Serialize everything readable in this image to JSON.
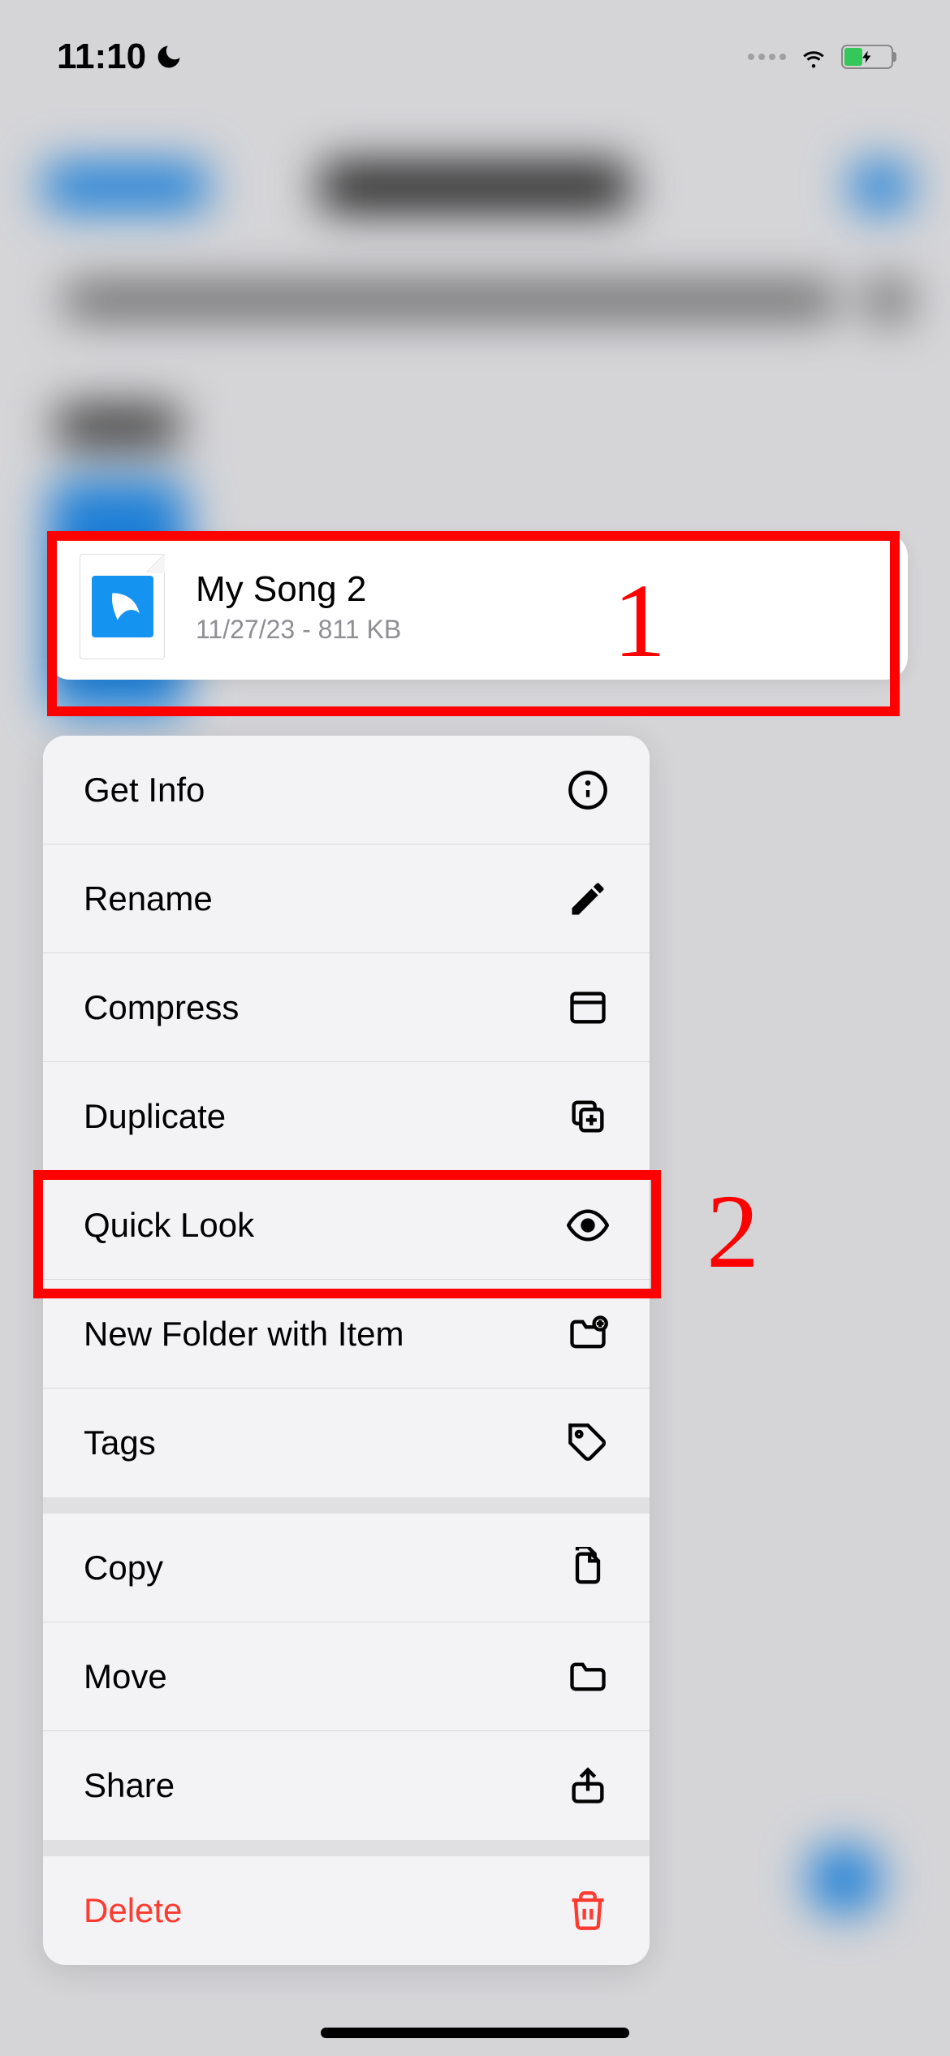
{
  "status_bar": {
    "time": "11:10"
  },
  "file": {
    "name": "My Song 2",
    "date": "11/27/23",
    "size": "811 KB"
  },
  "menu": {
    "get_info": "Get Info",
    "rename": "Rename",
    "compress": "Compress",
    "duplicate": "Duplicate",
    "quick_look": "Quick Look",
    "new_folder": "New Folder with Item",
    "tags": "Tags",
    "copy": "Copy",
    "move": "Move",
    "share": "Share",
    "delete": "Delete"
  },
  "annotations": {
    "one": "1",
    "two": "2"
  }
}
